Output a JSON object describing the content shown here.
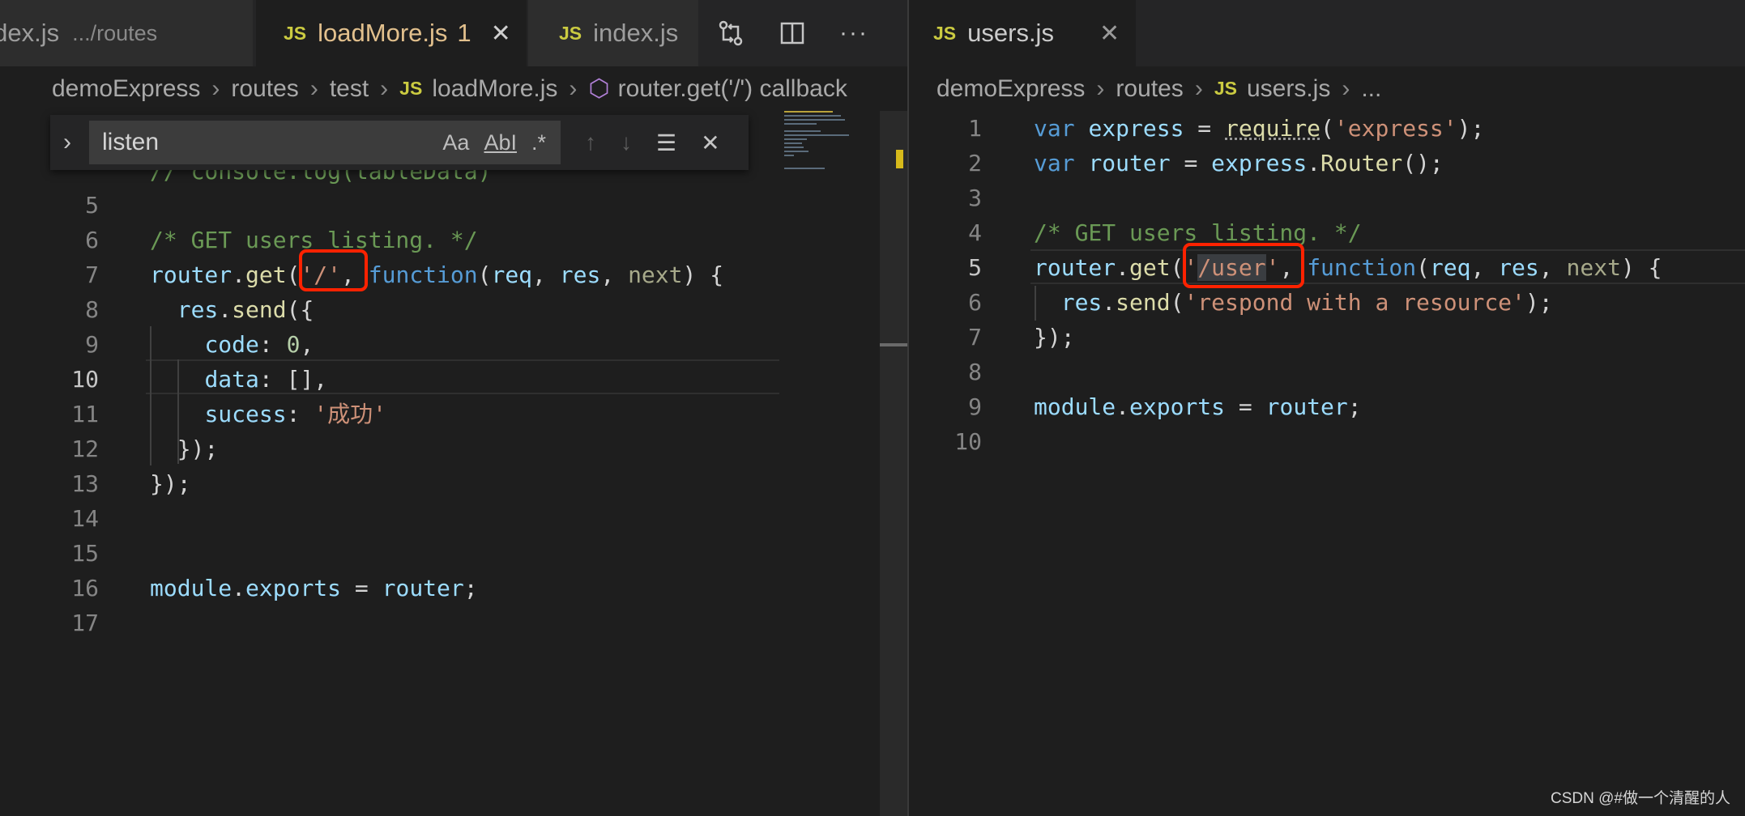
{
  "left_editor": {
    "tabs": [
      {
        "label": "index.js",
        "description": ".../routes"
      },
      {
        "label": "loadMore.js",
        "problems": "1"
      },
      {
        "label": "index.js",
        "description": ""
      }
    ],
    "js_badge": "JS",
    "breadcrumb": [
      "demoExpress",
      "routes",
      "test",
      "loadMore.js",
      "router.get('/') callback"
    ],
    "find": {
      "query": "listen",
      "match_case": "Aa",
      "whole_word": "AbI",
      "regex": ".*"
    },
    "current_line": "10",
    "lines": [
      {
        "num": "5",
        "code": ""
      },
      {
        "num": "6",
        "code": "/* GET users listing. */"
      },
      {
        "num": "7",
        "code": "router.get('/', function(req, res, next) {"
      },
      {
        "num": "8",
        "code": "  res.send({"
      },
      {
        "num": "9",
        "code": "    code: 0,"
      },
      {
        "num": "10",
        "code": "    data: [],"
      },
      {
        "num": "11",
        "code": "    sucess: '成功'"
      },
      {
        "num": "12",
        "code": "  });"
      },
      {
        "num": "13",
        "code": "});"
      },
      {
        "num": "14",
        "code": ""
      },
      {
        "num": "15",
        "code": ""
      },
      {
        "num": "16",
        "code": "module.exports = router;"
      },
      {
        "num": "17",
        "code": ""
      }
    ],
    "partial_top_line": "// console.log(tableData)"
  },
  "right_editor": {
    "tabs": [
      {
        "label": "users.js"
      }
    ],
    "breadcrumb": [
      "demoExpress",
      "routes",
      "users.js",
      "..."
    ],
    "current_line": "5",
    "lines": [
      {
        "num": "1",
        "code": "var express = require('express');"
      },
      {
        "num": "2",
        "code": "var router = express.Router();"
      },
      {
        "num": "3",
        "code": ""
      },
      {
        "num": "4",
        "code": "/* GET users listing. */"
      },
      {
        "num": "5",
        "code": "router.get('/user', function(req, res, next) {"
      },
      {
        "num": "6",
        "code": "  res.send('respond with a resource');"
      },
      {
        "num": "7",
        "code": "});"
      },
      {
        "num": "8",
        "code": ""
      },
      {
        "num": "9",
        "code": "module.exports = router;"
      },
      {
        "num": "10",
        "code": ""
      }
    ]
  },
  "colors": {
    "keyword": "#569cd6",
    "variable": "#9cdcfe",
    "function": "#dcdcaa",
    "string": "#ce9178",
    "number": "#b5cea8",
    "comment": "#6a9955",
    "highlight_box": "#ff2200"
  },
  "watermark": "CSDN @#做一个清醒的人"
}
